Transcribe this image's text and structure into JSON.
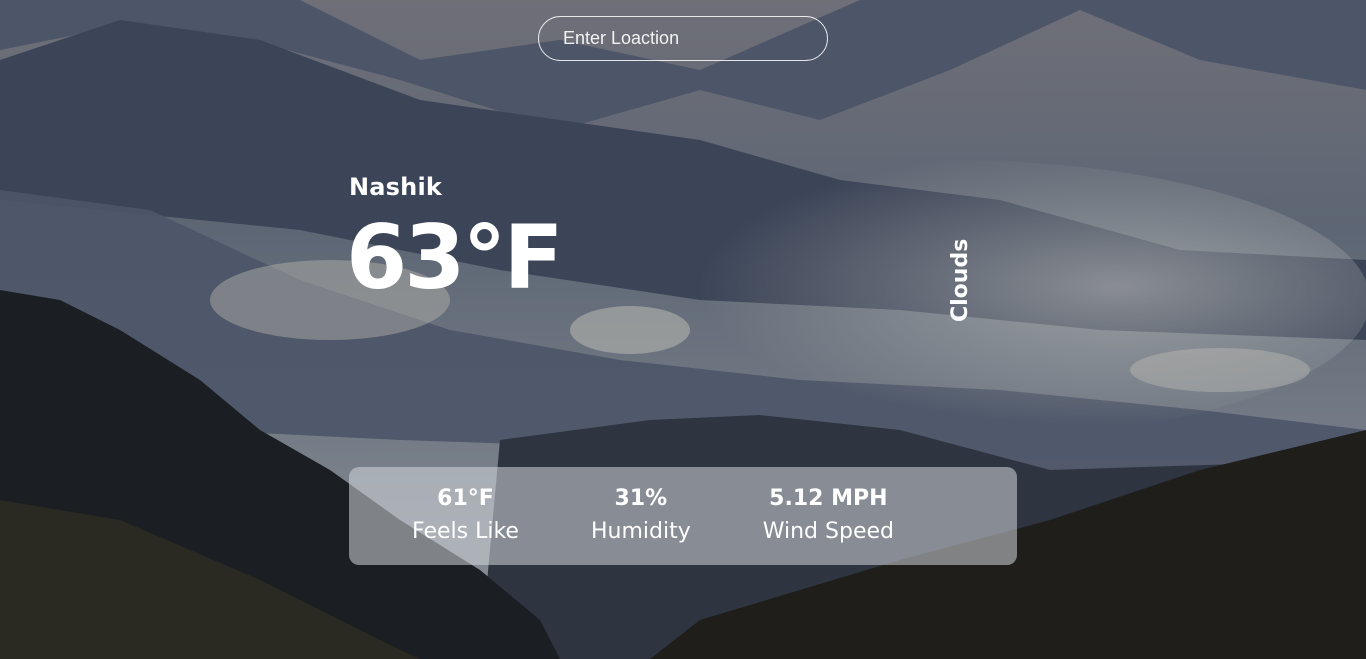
{
  "search": {
    "placeholder": "Enter Loaction"
  },
  "weather": {
    "city": "Nashik",
    "temperature": "63°F",
    "condition": "Clouds"
  },
  "stats": [
    {
      "value": "61°F",
      "label": "Feels Like"
    },
    {
      "value": "31%",
      "label": "Humidity"
    },
    {
      "value": "5.12 MPH",
      "label": "Wind Speed"
    }
  ]
}
